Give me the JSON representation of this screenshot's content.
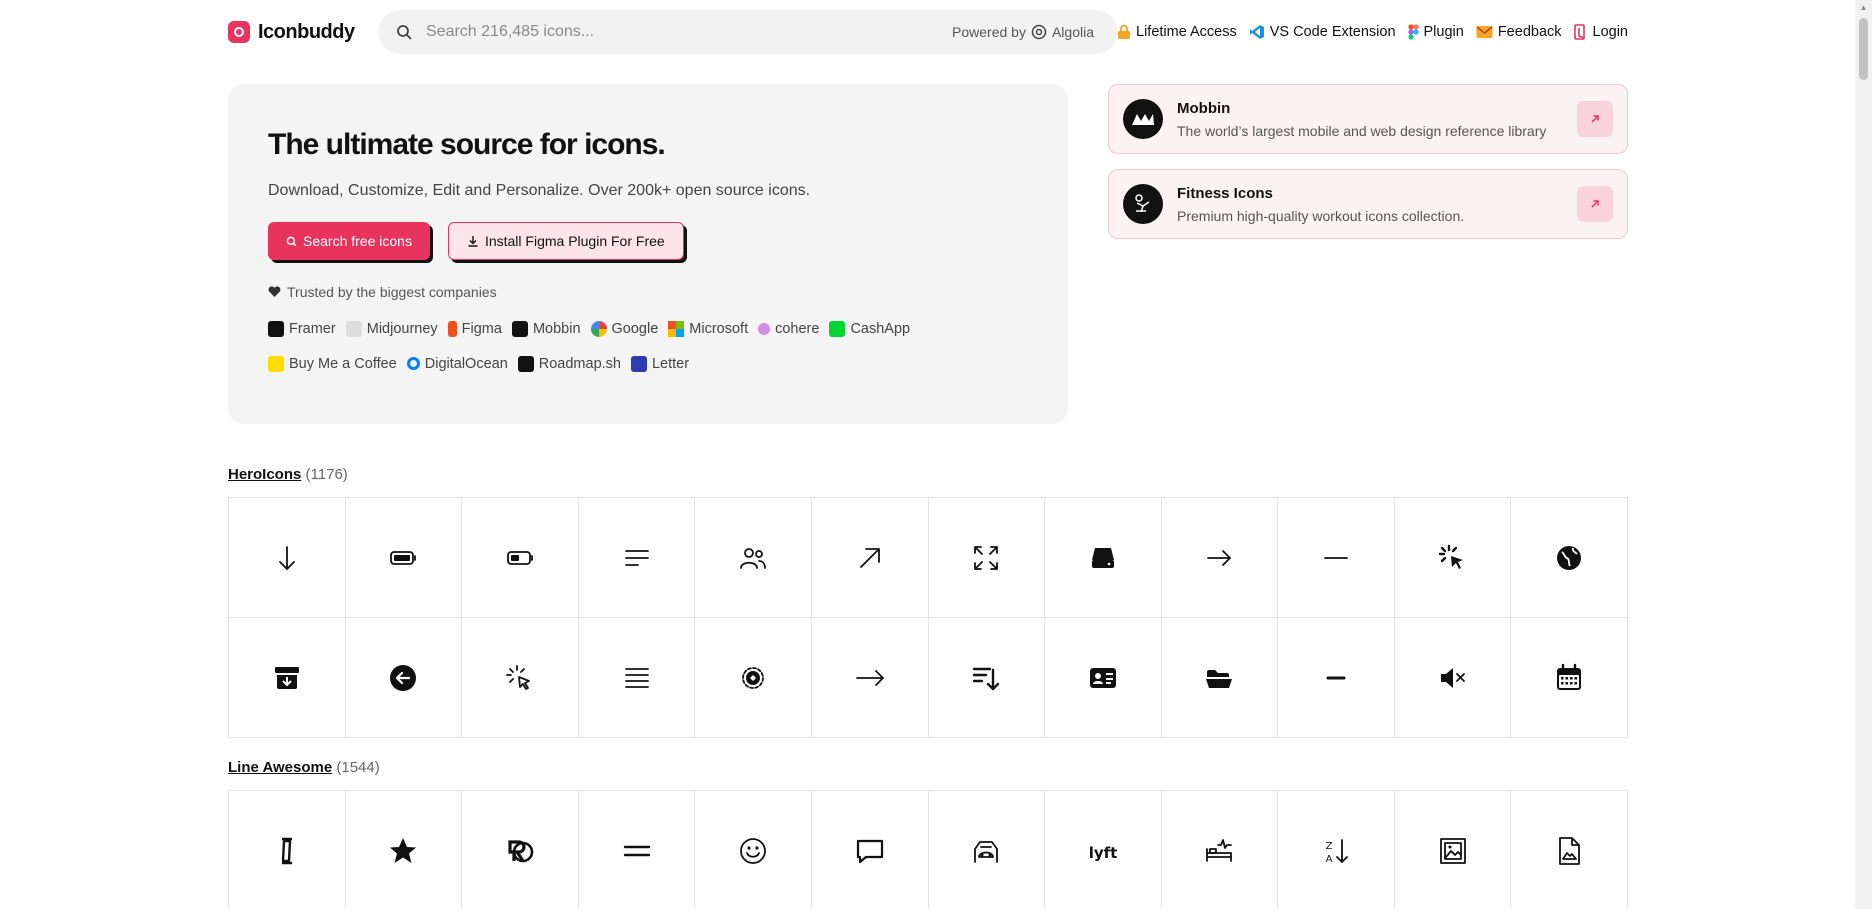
{
  "header": {
    "logo_text": "Iconbuddy",
    "search_placeholder": "Search 216,485 icons...",
    "powered_by": "Powered by",
    "algolia": "Algolia",
    "nav": [
      {
        "label": "Lifetime Access",
        "icon": "lock-icon"
      },
      {
        "label": "VS Code Extension",
        "icon": "vscode-icon"
      },
      {
        "label": "Plugin",
        "icon": "figma-icon"
      },
      {
        "label": "Feedback",
        "icon": "mail-icon"
      },
      {
        "label": "Login",
        "icon": "login-icon"
      }
    ]
  },
  "hero": {
    "title": "The ultimate source for icons.",
    "subtitle": "Download, Customize, Edit and Personalize. Over 200k+ open source icons.",
    "primary_button": "Search free icons",
    "secondary_button": "Install Figma Plugin For Free",
    "trusted": "Trusted by the biggest companies",
    "companies": [
      {
        "name": "Framer",
        "color": "#111111"
      },
      {
        "name": "Midjourney",
        "color": "#bbbbbb"
      },
      {
        "name": "Figma",
        "color": "#f24e1e"
      },
      {
        "name": "Mobbin",
        "color": "#111111"
      },
      {
        "name": "Google",
        "color": "#4285f4"
      },
      {
        "name": "Microsoft",
        "color": "#f25022"
      },
      {
        "name": "cohere",
        "color": "#d18ee2"
      },
      {
        "name": "CashApp",
        "color": "#00d632"
      },
      {
        "name": "Buy Me a Coffee",
        "color": "#ffdd00"
      },
      {
        "name": "DigitalOcean",
        "color": "#0080ff"
      },
      {
        "name": "Roadmap.sh",
        "color": "#111111"
      },
      {
        "name": "Letter",
        "color": "#2d3cb5"
      }
    ]
  },
  "ads": [
    {
      "title": "Mobbin",
      "description": "The world’s largest mobile and web design reference library"
    },
    {
      "title": "Fitness Icons",
      "description": "Premium high-quality workout icons collection."
    }
  ],
  "sets": [
    {
      "name": "HeroIcons",
      "count": "(1176)",
      "icons": [
        "arrow-down-icon",
        "battery-full-icon",
        "battery-half-icon",
        "bars-left-icon",
        "users-icon",
        "arrow-up-right-icon",
        "expand-icon",
        "server-icon",
        "arrow-right-icon",
        "minus-icon",
        "cursor-click-icon",
        "globe-icon",
        "archive-down-icon",
        "arrow-left-circle-icon",
        "cursor-rays-icon",
        "bars-icon",
        "cog-icon",
        "arrow-right-long-icon",
        "sort-down-icon",
        "id-card-icon",
        "folder-open-icon",
        "minus-small-icon",
        "speaker-x-icon",
        "calendar-icon"
      ]
    },
    {
      "name": "Line Awesome",
      "count": "(1544)",
      "icons": [
        "i-cursor-icon",
        "star-icon",
        "registered-icon",
        "equals-icon",
        "smile-icon",
        "comment-icon",
        "car-crash-icon",
        "lyft-icon",
        "bed-pulse-icon",
        "sort-alpha-down-icon",
        "image-frame-icon",
        "file-image-icon"
      ]
    }
  ]
}
